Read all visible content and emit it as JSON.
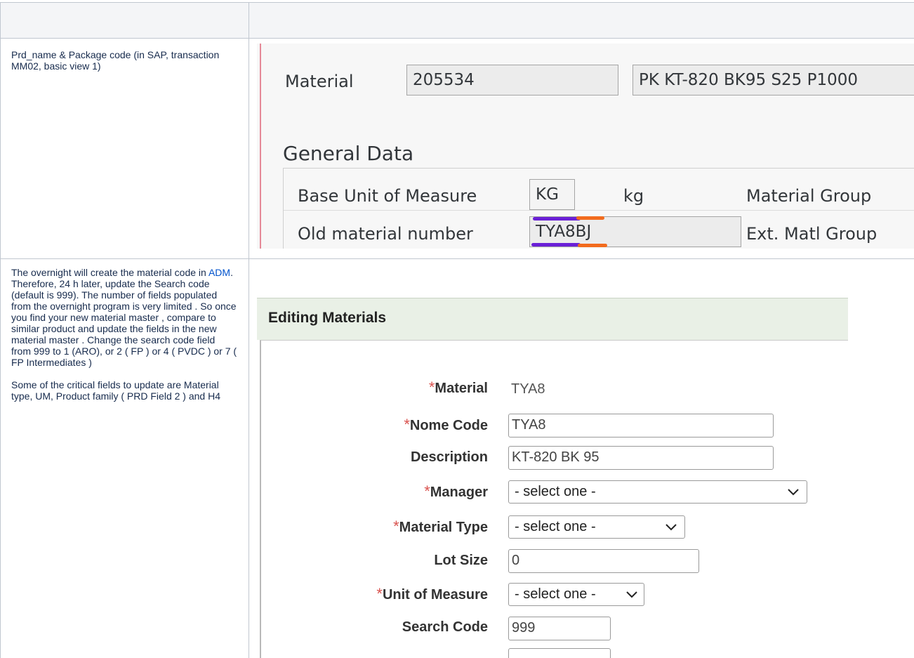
{
  "left_column": {
    "row1_text": "Prd_name & Package code (in SAP, transaction MM02, basic view 1)",
    "row2_text_before_link": "The overnight will create the material code in ",
    "row2_link": "ADM",
    "row2_text_after_link": ". Therefore, 24 h later, update the Search code (default is 999). The number of fields populated from  the overnight  program is very limited . So once you find your new material master , compare to similar product and update the fields in the new material master .   Change the search code field from 999 to 1 (ARO), or 2 ( FP ) or 4 ( PVDC ) or 7 ( FP Intermediates )",
    "row2_text_para2": "Some of the critical fields to update are Material type, UM, Product family ( PRD Field 2 ) and H4"
  },
  "sap": {
    "material_label": "Material",
    "material_value": "205534",
    "material_desc": "PK KT-820 BK95 S25 P1000",
    "section_title": "General Data",
    "base_uom_label": "Base Unit of Measure",
    "base_uom_value": "KG",
    "base_uom_text": "kg",
    "material_group_label": "Material Group",
    "old_material_label": "Old material number",
    "old_material_value": "TYA8BJ",
    "ext_matl_group_label": "Ext. Matl Group",
    "colors": {
      "highlight_purple": "#6a1fd6",
      "highlight_orange": "#f26b1d"
    }
  },
  "adm": {
    "title": "Editing Materials",
    "required_mark": "*",
    "fields": {
      "material_label": "Material",
      "material_value": "TYA8",
      "nome_code_label": "Nome Code",
      "nome_code_value": "TYA8",
      "description_label": "Description",
      "description_value": "KT-820 BK 95",
      "manager_label": "Manager",
      "manager_value": "- select one -",
      "material_type_label": "Material Type",
      "material_type_value": "- select one -",
      "lot_size_label": "Lot Size",
      "lot_size_value": "0",
      "uom_label": "Unit of Measure",
      "uom_value": "- select one -",
      "search_code_label": "Search Code",
      "search_code_value": "999"
    },
    "icons": {
      "dropdown": "chevron-down-icon"
    },
    "colors": {
      "required": "#d9534f",
      "title_bar": "#e9f0e6"
    }
  }
}
